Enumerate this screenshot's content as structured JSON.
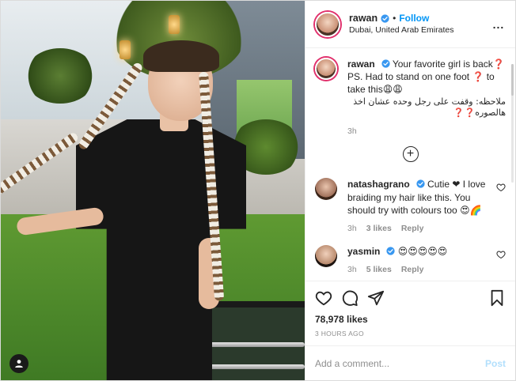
{
  "post": {
    "photo_alt": "Woman with long braids in black t-shirt",
    "user_badge_icon": "user-icon"
  },
  "header": {
    "username": "rawan",
    "separator": "•",
    "follow_label": "Follow",
    "location": "Dubai, United Arab Emirates",
    "more_label": "..."
  },
  "caption": {
    "username": "rawan",
    "text": "Your favorite girl is back❓ PS. Had to stand on one foot ❓ to take this😩😩",
    "arabic": "ملاحظه: وقفت على رجل وحده عشان اخذ هالصوره❓❓",
    "time": "3h"
  },
  "load_more_label": "+",
  "comments": [
    {
      "username": "natashagrano",
      "text": "Cutie ❤ I love braiding my hair like this. You should try with colours too 😍🌈",
      "time": "3h",
      "likes": "3 likes",
      "reply": "Reply"
    },
    {
      "username": "yasmin",
      "text": "😍😍😍😍😍",
      "time": "3h",
      "likes": "5 likes",
      "reply": "Reply"
    }
  ],
  "actions": {
    "likes": "78,978 likes",
    "timestamp": "3 HOURS AGO"
  },
  "add_comment": {
    "placeholder": "Add a comment...",
    "post_label": "Post"
  },
  "colors": {
    "follow": "#0095f6",
    "post_disabled": "#b2dffc",
    "verified": "#3897f0"
  }
}
